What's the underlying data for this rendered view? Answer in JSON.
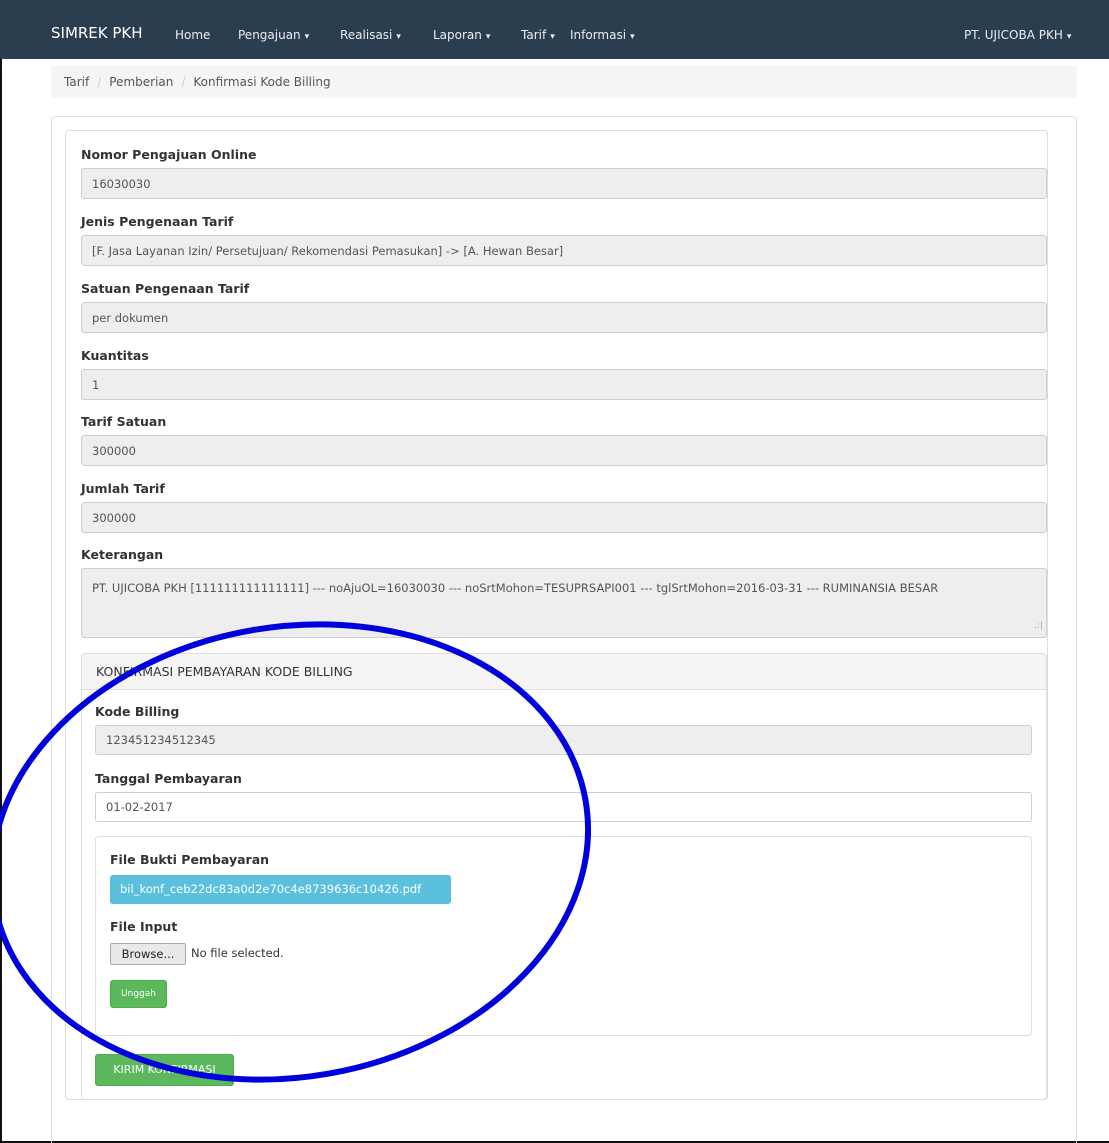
{
  "navbar": {
    "brand": "SIMREK PKH",
    "items": [
      {
        "label": "Home",
        "has_caret": false
      },
      {
        "label": "Pengajuan",
        "has_caret": true
      },
      {
        "label": "Realisasi",
        "has_caret": true
      },
      {
        "label": "Laporan",
        "has_caret": true
      },
      {
        "label": "Tarif",
        "has_caret": true
      },
      {
        "label": "Informasi",
        "has_caret": true
      }
    ],
    "user": "PT. UJICOBA PKH",
    "caret": "▾",
    "background_color": "#2b3e50"
  },
  "breadcrumb": [
    "Tarif",
    "Pemberian",
    "Konfirmasi Kode Billing"
  ],
  "form": {
    "nomor_label": "Nomor Pengajuan Online",
    "nomor_value": "16030030",
    "jenis_label": "Jenis Pengenaan Tarif",
    "jenis_value": "[F. Jasa Layanan Izin/ Persetujuan/ Rekomendasi Pemasukan] -> [A. Hewan Besar]",
    "satuan_label": "Satuan Pengenaan Tarif",
    "satuan_value": "per dokumen",
    "kuantitas_label": "Kuantitas",
    "kuantitas_value": "1",
    "tarif_satuan_label": "Tarif Satuan",
    "tarif_satuan_value": "300000",
    "jumlah_label": "Jumlah Tarif",
    "jumlah_value": "300000",
    "keterangan_label": "Keterangan",
    "keterangan_value": "PT. UJICOBA PKH [111111111111111] --- noAjuOL=16030030 --- noSrtMohon=TESUPRSAPI001 --- tglSrtMohon=2016-03-31 --- RUMINANSIA BESAR"
  },
  "billing": {
    "heading": "KONFIRMASI PEMBAYARAN KODE BILLING",
    "kode_label": "Kode Billing",
    "kode_value": "123451234512345",
    "tanggal_label": "Tanggal Pembayaran",
    "tanggal_value": "01-02-2017",
    "file_bukti_label": "File Bukti Pembayaran",
    "file_bukti_name": "bil_konf_ceb22dc83a0d2e70c4e8739636c10426.pdf",
    "file_input_label": "File Input",
    "browse_label": "Browse...",
    "no_file_text": "No file selected.",
    "unggah_label": "Unggah",
    "kirim_label": "KIRIM KONFIRMASI"
  },
  "colors": {
    "info_button": "#5bc0de",
    "success_button": "#5cb85c",
    "annotation_ellipse": "#0000dd"
  },
  "icons": {
    "resize_grip": "resize-grip-icon"
  }
}
